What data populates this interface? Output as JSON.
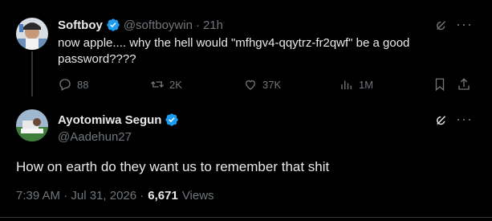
{
  "reply_parent": {
    "display_name": "Softboy",
    "handle": "@softboywin",
    "separator": "·",
    "time_ago": "21h",
    "text_line1": "now apple.... why the hell would \"mfhgv4-qqytrz-fr2qwf\" be a good",
    "text_line2": "password????",
    "actions": {
      "replies": "88",
      "reposts": "2K",
      "likes": "37K",
      "views": "1M"
    }
  },
  "main_tweet": {
    "display_name": "Ayotomiwa Segun",
    "handle": "@Aadehun27",
    "text": "How on earth do they want us to remember that shit",
    "timestamp": "7:39 AM · Jul 31, 2026 ·",
    "views_count": "6,671",
    "views_label": "Views"
  },
  "colors": {
    "verified": "#1d9bf0",
    "muted": "#71767b",
    "text": "#e7e9ea",
    "background": "#000000"
  },
  "icons": [
    "verified-badge-icon",
    "grok-icon",
    "more-icon",
    "reply-icon",
    "repost-icon",
    "like-icon",
    "views-icon",
    "bookmark-icon",
    "share-icon"
  ]
}
